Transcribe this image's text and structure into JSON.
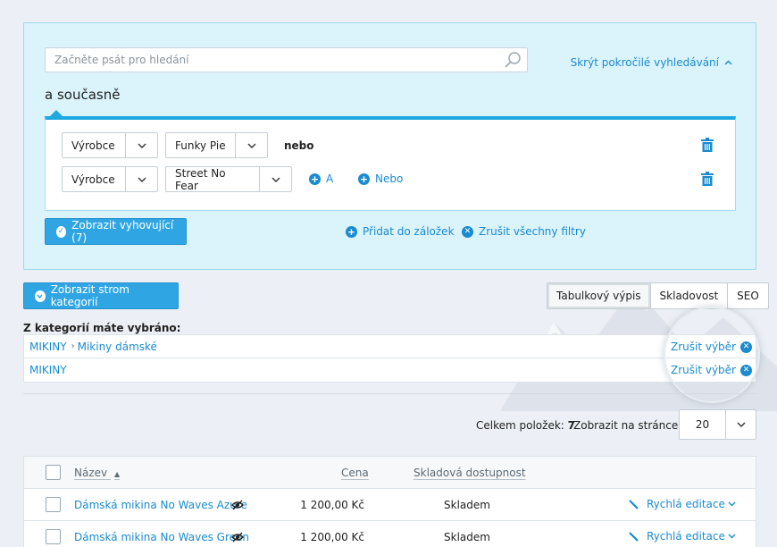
{
  "search": {
    "placeholder": "Začněte psát pro hledání",
    "toggle_advanced": "Skrýt pokročilé vyhledávání",
    "and_title": "a současně",
    "filters": [
      {
        "field": "Výrobce",
        "value": "Funky Pie",
        "connector": "nebo"
      },
      {
        "field": "Výrobce",
        "value": "Street No Fear"
      }
    ],
    "add_and": "A",
    "add_or": "Nebo",
    "show_matching": "Zobrazit vyhovující (7)",
    "add_bookmark": "Přidat do záložek",
    "clear_filters": "Zrušit všechny filtry"
  },
  "category": {
    "show_tree": "Zobrazit strom kategorií",
    "selected_heading": "Z kategorií máte vybráno:",
    "rows": [
      {
        "parent": "MIKINY",
        "child": "Mikiny dámské",
        "clear": "Zrušit výběr"
      },
      {
        "parent": "MIKINY",
        "clear": "Zrušit výběr"
      }
    ]
  },
  "view_tabs": [
    "Tabulkový výpis",
    "Skladovost",
    "SEO"
  ],
  "paging": {
    "total_label": "Celkem položek:",
    "total_value": "7",
    "per_page_label": "Zobrazit na stránce:",
    "per_page_value": "20"
  },
  "table": {
    "columns": {
      "name": "Název",
      "price": "Cena",
      "stock": "Skladová dostupnost"
    },
    "rows": [
      {
        "name": "Dámská mikina No Waves Azure",
        "price": "1 200,00 Kč",
        "stock": "Skladem",
        "edit": "Rychlá editace"
      },
      {
        "name": "Dámská mikina No Waves Green",
        "price": "1 200,00 Kč",
        "stock": "Skladem",
        "edit": "Rychlá editace"
      }
    ]
  },
  "colors": {
    "accent": "#1a8bd0",
    "primary_button": "#2fa6e3",
    "panel_bg": "#dbf3fb"
  }
}
